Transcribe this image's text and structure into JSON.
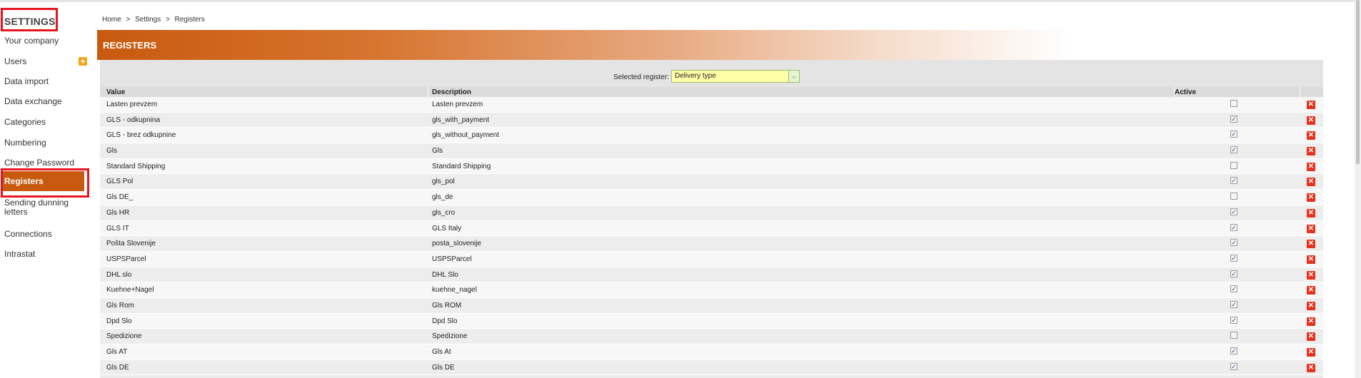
{
  "sidebar": {
    "title": "SETTINGS",
    "items": [
      {
        "label": "Your company"
      },
      {
        "label": "Users"
      },
      {
        "label": "Data import"
      },
      {
        "label": "Data exchange"
      },
      {
        "label": "Categories"
      },
      {
        "label": "Numbering"
      },
      {
        "label": "Change Password"
      },
      {
        "label": "Registers",
        "active": true
      },
      {
        "label": "Sending dunning letters"
      },
      {
        "label": "Connections"
      },
      {
        "label": "Intrastat"
      }
    ],
    "add_user_icon": "+"
  },
  "breadcrumb": [
    "Home",
    ">",
    "Settings",
    ">",
    "Registers"
  ],
  "page": {
    "title": "REGISTERS"
  },
  "register_select": {
    "label": "Selected register:",
    "value": "Delivery type"
  },
  "table": {
    "columns": [
      "Value",
      "Description",
      "Active"
    ],
    "rows": [
      {
        "value": "Lasten prevzem",
        "description": "Lasten prevzem",
        "active": false
      },
      {
        "value": "GLS - odkupnina",
        "description": "gls_with_payment",
        "active": true
      },
      {
        "value": "GLS - brez odkupnine",
        "description": "gls_without_payment",
        "active": true
      },
      {
        "value": "Gls",
        "description": "Gls",
        "active": true
      },
      {
        "value": "Standard Shipping",
        "description": "Standard Shipping",
        "active": false
      },
      {
        "value": "GLS Pol",
        "description": "gls_pol",
        "active": true
      },
      {
        "value": "Gls DE_",
        "description": "gls_de",
        "active": false
      },
      {
        "value": "Gls HR",
        "description": "gls_cro",
        "active": true
      },
      {
        "value": "GLS IT",
        "description": "GLS Italy",
        "active": true
      },
      {
        "value": "Pošta Slovenije",
        "description": "posta_slovenije",
        "active": true
      },
      {
        "value": "USPSParcel",
        "description": "USPSParcel",
        "active": true
      },
      {
        "value": "DHL slo",
        "description": "DHL Slo",
        "active": true
      },
      {
        "value": "Kuehne+Nagel",
        "description": "kuehne_nagel",
        "active": true
      },
      {
        "value": "Gls Rom",
        "description": "Gls ROM",
        "active": true
      },
      {
        "value": "Dpd Slo",
        "description": "Dpd Slo",
        "active": true
      },
      {
        "value": "Spedizione",
        "description": "Spedizione",
        "active": false
      },
      {
        "value": "Gls AT",
        "description": "Gls At",
        "active": true
      },
      {
        "value": "Gls DE",
        "description": "Gls DE",
        "active": true
      }
    ]
  },
  "colors": {
    "accent": "#c85a10",
    "highlight": "#e8141f",
    "delete": "#e5321d"
  }
}
